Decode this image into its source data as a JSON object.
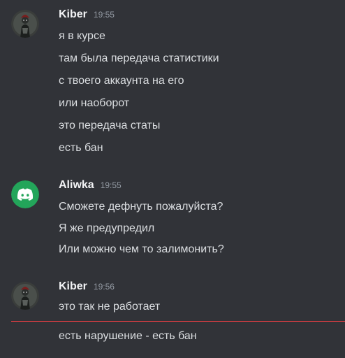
{
  "messages": [
    {
      "author": "Kiber",
      "time": "19:55",
      "avatar_icon": "dark-figure-avatar",
      "lines": [
        "я в курсе",
        "там была передача статистики",
        "с твоего аккаунта на его",
        "или наоборот",
        "это передача статы",
        "есть бан"
      ]
    },
    {
      "author": "Aliwka",
      "time": "19:55",
      "avatar_icon": "discord-logo-avatar",
      "lines": [
        "Сможете дефнуть пожалуйста?",
        "Я же предупредил",
        "Или можно чем то залимонить?"
      ]
    },
    {
      "author": "Kiber",
      "time": "19:56",
      "avatar_icon": "dark-figure-avatar",
      "lines": [
        "это так не работает",
        "есть нарушение - есть бан"
      ]
    }
  ],
  "colors": {
    "background": "#313338",
    "text": "#dbdee1",
    "username": "#f2f3f5",
    "timestamp": "#949ba4",
    "discord_green": "#23a55a",
    "new_messages_divider": "#f23f43"
  }
}
